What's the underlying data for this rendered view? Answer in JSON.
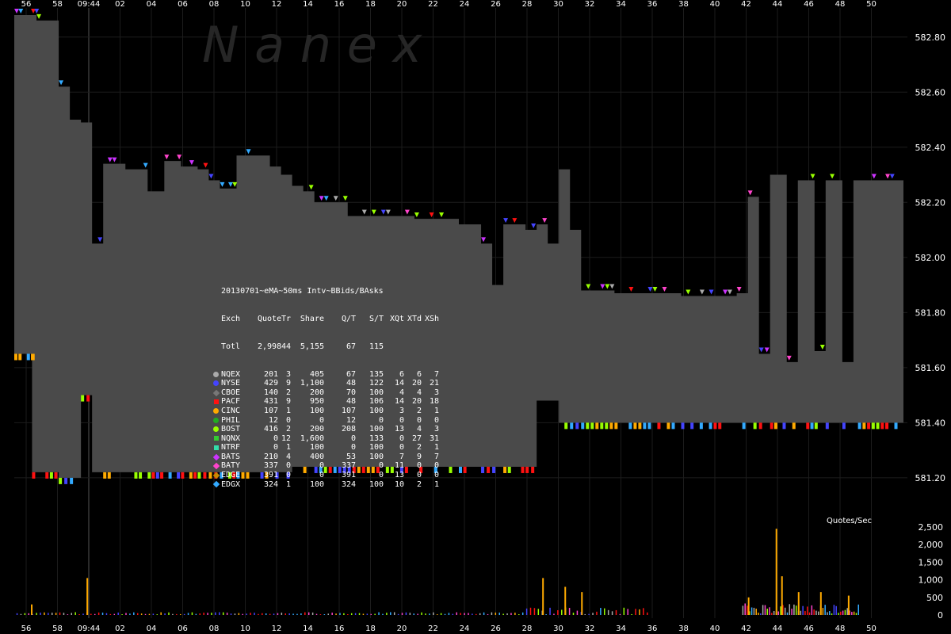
{
  "chart_data": [
    {
      "type": "line",
      "title": "",
      "watermark": "N  a  n  e  x",
      "xlabel": "",
      "ylabel": "",
      "x_tick_labels": [
        "56",
        "58",
        "09:44",
        "02",
        "04",
        "06",
        "08",
        "10",
        "12",
        "14",
        "16",
        "18",
        "20",
        "22",
        "24",
        "26",
        "28",
        "30",
        "32",
        "34",
        "36",
        "38",
        "40",
        "42",
        "44",
        "46",
        "48",
        "50"
      ],
      "ylim": [
        581.05,
        582.9
      ],
      "y_tick_labels": [
        "582.80",
        "582.60",
        "582.40",
        "582.20",
        "582.00",
        "581.80",
        "581.60",
        "581.40",
        "581.20"
      ],
      "series": [
        {
          "name": "",
          "color": "#4a4a4a",
          "values": [
            {
              "t": 0,
              "bid": 581.65,
              "ask": 582.88
            },
            {
              "t": 1.5,
              "bid": 581.65,
              "ask": 582.88
            },
            {
              "t": 1.6,
              "bid": 581.22,
              "ask": 582.88
            },
            {
              "t": 2.0,
              "bid": 581.22,
              "ask": 582.86
            },
            {
              "t": 4.0,
              "bid": 581.2,
              "ask": 582.62
            },
            {
              "t": 5.0,
              "bid": 581.2,
              "ask": 582.5
            },
            {
              "t": 6.0,
              "bid": 581.5,
              "ask": 582.49
            },
            {
              "t": 7.0,
              "bid": 581.22,
              "ask": 582.05
            },
            {
              "t": 8.0,
              "bid": 581.22,
              "ask": 582.34
            },
            {
              "t": 10.0,
              "bid": 581.22,
              "ask": 582.32
            },
            {
              "t": 12.0,
              "bid": 581.22,
              "ask": 582.24
            },
            {
              "t": 13.5,
              "bid": 581.22,
              "ask": 582.35
            },
            {
              "t": 15.0,
              "bid": 581.22,
              "ask": 582.33
            },
            {
              "t": 16.5,
              "bid": 581.22,
              "ask": 582.32
            },
            {
              "t": 17.5,
              "bid": 581.22,
              "ask": 582.28
            },
            {
              "t": 18.5,
              "bid": 581.22,
              "ask": 582.25
            },
            {
              "t": 20.0,
              "bid": 581.22,
              "ask": 582.37
            },
            {
              "t": 23.0,
              "bid": 581.22,
              "ask": 582.33
            },
            {
              "t": 24.0,
              "bid": 581.22,
              "ask": 582.3
            },
            {
              "t": 25.0,
              "bid": 581.24,
              "ask": 582.26
            },
            {
              "t": 26.0,
              "bid": 581.24,
              "ask": 582.24
            },
            {
              "t": 27.0,
              "bid": 581.24,
              "ask": 582.2
            },
            {
              "t": 30.0,
              "bid": 581.24,
              "ask": 582.15
            },
            {
              "t": 36.0,
              "bid": 581.24,
              "ask": 582.14
            },
            {
              "t": 40.0,
              "bid": 581.24,
              "ask": 582.12
            },
            {
              "t": 42.0,
              "bid": 581.24,
              "ask": 582.05
            },
            {
              "t": 43.0,
              "bid": 581.24,
              "ask": 581.9
            },
            {
              "t": 44.0,
              "bid": 581.24,
              "ask": 582.12
            },
            {
              "t": 46.0,
              "bid": 581.24,
              "ask": 582.1
            },
            {
              "t": 47.0,
              "bid": 581.48,
              "ask": 582.12
            },
            {
              "t": 48.0,
              "bid": 581.48,
              "ask": 582.05
            },
            {
              "t": 49.0,
              "bid": 581.4,
              "ask": 582.32
            },
            {
              "t": 50.0,
              "bid": 581.4,
              "ask": 582.1
            },
            {
              "t": 51.0,
              "bid": 581.4,
              "ask": 581.88
            },
            {
              "t": 54.0,
              "bid": 581.4,
              "ask": 581.87
            },
            {
              "t": 60.0,
              "bid": 581.4,
              "ask": 581.86
            },
            {
              "t": 65.0,
              "bid": 581.4,
              "ask": 581.87
            },
            {
              "t": 66.0,
              "bid": 581.4,
              "ask": 582.22
            },
            {
              "t": 67.0,
              "bid": 581.4,
              "ask": 581.65
            },
            {
              "t": 68.0,
              "bid": 581.4,
              "ask": 582.3
            },
            {
              "t": 69.5,
              "bid": 581.4,
              "ask": 581.62
            },
            {
              "t": 70.5,
              "bid": 581.4,
              "ask": 582.28
            },
            {
              "t": 72.0,
              "bid": 581.4,
              "ask": 581.66
            },
            {
              "t": 73.0,
              "bid": 581.4,
              "ask": 582.28
            },
            {
              "t": 74.5,
              "bid": 581.4,
              "ask": 581.62
            },
            {
              "t": 75.5,
              "bid": 581.4,
              "ask": 582.28
            },
            {
              "t": 80.0,
              "bid": 581.4,
              "ask": 582.28
            }
          ]
        }
      ]
    },
    {
      "type": "bar",
      "title": "Quotes/Sec",
      "ylim": [
        0,
        2500
      ],
      "y_tick_labels": [
        "2,500",
        "2,000",
        "1,500",
        "1,000",
        "500",
        "0"
      ],
      "spikes": [
        {
          "t": 1.5,
          "v": 300
        },
        {
          "t": 6.5,
          "v": 1050
        },
        {
          "t": 47.5,
          "v": 1050
        },
        {
          "t": 49.5,
          "v": 800
        },
        {
          "t": 51.0,
          "v": 650
        },
        {
          "t": 66.0,
          "v": 500
        },
        {
          "t": 68.5,
          "v": 2450
        },
        {
          "t": 69.0,
          "v": 1100
        },
        {
          "t": 70.5,
          "v": 650
        },
        {
          "t": 72.5,
          "v": 650
        },
        {
          "t": 75.0,
          "v": 550
        }
      ]
    }
  ],
  "legend": {
    "title": "20130701~eMA~50ms Intv~BBids/BAsks",
    "headers": [
      "Exch",
      "Quote",
      "Tr",
      "Share",
      "Q/T",
      "S/T",
      "XQt",
      "XTd",
      "XSh"
    ],
    "total": [
      "Totl",
      "2,998",
      "44",
      "5,155",
      "67",
      "115",
      "",
      "",
      ""
    ],
    "rows": [
      {
        "ex": "NQEX",
        "sym": "dot",
        "color": "#aaaaaa",
        "vals": [
          "201",
          "3",
          "405",
          "67",
          "135",
          "6",
          "6",
          "7"
        ]
      },
      {
        "ex": "NYSE",
        "sym": "dot",
        "color": "#4444ff",
        "vals": [
          "429",
          "9",
          "1,100",
          "48",
          "122",
          "14",
          "20",
          "21"
        ]
      },
      {
        "ex": "CBOE",
        "sym": "diamond",
        "color": "#777777",
        "vals": [
          "140",
          "2",
          "200",
          "70",
          "100",
          "4",
          "4",
          "3"
        ]
      },
      {
        "ex": "PACF",
        "sym": "square",
        "color": "#ff1111",
        "vals": [
          "431",
          "9",
          "950",
          "48",
          "106",
          "14",
          "20",
          "18"
        ]
      },
      {
        "ex": "CINC",
        "sym": "dot",
        "color": "#ffaa00",
        "vals": [
          "107",
          "1",
          "100",
          "107",
          "100",
          "3",
          "2",
          "1"
        ]
      },
      {
        "ex": "PHIL",
        "sym": "dot",
        "color": "#22aa22",
        "vals": [
          "12",
          "0",
          "0",
          "12",
          "0",
          "0",
          "0",
          "0"
        ]
      },
      {
        "ex": "BOST",
        "sym": "dot",
        "color": "#99ff00",
        "vals": [
          "416",
          "2",
          "200",
          "208",
          "100",
          "13",
          "4",
          "3"
        ]
      },
      {
        "ex": "NQNX",
        "sym": "square",
        "color": "#33cc33",
        "vals": [
          "0",
          "12",
          "1,600",
          "0",
          "133",
          "0",
          "27",
          "31"
        ]
      },
      {
        "ex": "NTRF",
        "sym": "square",
        "color": "#33ddaa",
        "vals": [
          "0",
          "1",
          "100",
          "0",
          "100",
          "0",
          "2",
          "1"
        ]
      },
      {
        "ex": "BATS",
        "sym": "diamond",
        "color": "#cc33ff",
        "vals": [
          "210",
          "4",
          "400",
          "53",
          "100",
          "7",
          "9",
          "7"
        ]
      },
      {
        "ex": "BATY",
        "sym": "diamond",
        "color": "#ff44cc",
        "vals": [
          "337",
          "0",
          "0",
          "337",
          "0",
          "11",
          "0",
          "0"
        ]
      },
      {
        "ex": "EDGE",
        "sym": "diamond",
        "color": "#cc8800",
        "vals": [
          "391",
          "0",
          "0",
          "391",
          "0",
          "13",
          "0",
          "0"
        ]
      },
      {
        "ex": "EDGX",
        "sym": "diamond",
        "color": "#33aaff",
        "vals": [
          "324",
          "1",
          "100",
          "324",
          "100",
          "10",
          "2",
          "1"
        ]
      }
    ]
  },
  "colors": {
    "background": "#000000",
    "spread_fill": "#4a4a4a",
    "grid": "#1e1e1e",
    "watermark": "#2a2a2a",
    "bid_marks": [
      "#ff1111",
      "#99ff00",
      "#ffaa00",
      "#33aaff",
      "#4444ff"
    ],
    "ask_marks": [
      "#ff44cc",
      "#cc33ff",
      "#99ff00",
      "#4444ff",
      "#ff1111",
      "#aaaaaa",
      "#33aaff"
    ]
  },
  "quotes_label": "Quotes/Sec"
}
